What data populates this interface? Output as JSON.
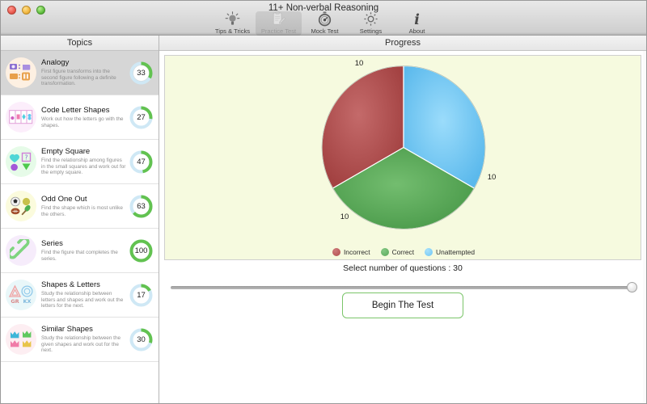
{
  "window": {
    "title": "11+ Non-verbal Reasoning",
    "traffic_lights": [
      "close-button",
      "minimize-button",
      "zoom-button"
    ]
  },
  "toolbar": {
    "items": [
      {
        "label": "Tips & Tricks",
        "icon": "lightbulb-icon",
        "selected": false
      },
      {
        "label": "Practice Test",
        "icon": "clipboard-pencil-icon",
        "selected": true
      },
      {
        "label": "Mock Test",
        "icon": "stopwatch-icon",
        "selected": false
      },
      {
        "label": "Settings",
        "icon": "gear-icon",
        "selected": false
      },
      {
        "label": "About",
        "icon": "info-icon",
        "selected": false
      }
    ]
  },
  "sidebar": {
    "header": "Topics",
    "items": [
      {
        "title": "Analogy",
        "desc": "First figure transforms into the second figure following a definite transformation.",
        "score": "33",
        "percent": 33,
        "selected": true,
        "icon": "analogy-icon",
        "icon_bg": "#fdf0e2"
      },
      {
        "title": "Code Letter Shapes",
        "desc": "Work out how the letters go with the shapes.",
        "score": "27",
        "percent": 27,
        "selected": false,
        "icon": "code-letter-shapes-icon",
        "icon_bg": "#fceefb"
      },
      {
        "title": "Empty Square",
        "desc": "Find the relationship among figures in the small squares and work out for the empty square.",
        "score": "47",
        "percent": 47,
        "selected": false,
        "icon": "empty-square-icon",
        "icon_bg": "#e6fbe8"
      },
      {
        "title": "Odd One Out",
        "desc": "Find the shape which is most unlike the others.",
        "score": "63",
        "percent": 63,
        "selected": false,
        "icon": "odd-one-out-icon",
        "icon_bg": "#fbfbdd"
      },
      {
        "title": "Series",
        "desc": "Find the figure that completes the series.",
        "score": "100",
        "percent": 100,
        "selected": false,
        "icon": "chain-link-icon",
        "icon_bg": "#f6ecfb"
      },
      {
        "title": "Shapes & Letters",
        "desc": "Study the relationship between letters and shapes and work out the letters for the next.",
        "score": "17",
        "percent": 17,
        "selected": false,
        "icon": "shapes-letters-icon",
        "icon_bg": "#e9f7f9"
      },
      {
        "title": "Similar Shapes",
        "desc": "Study the relationship between the given shapes and work out for the next.",
        "score": "30",
        "percent": 30,
        "selected": false,
        "icon": "similar-shapes-icon",
        "icon_bg": "#fdeef2"
      }
    ]
  },
  "main": {
    "header": "Progress",
    "question_count_label": "Select number of questions : 30",
    "slider": {
      "value": 30,
      "min": 5,
      "max": 30,
      "percent": 100
    },
    "begin_button": "Begin The Test"
  },
  "chart_data": {
    "type": "pie",
    "title": "Progress",
    "categories": [
      "Incorrect",
      "Correct",
      "Unattempted"
    ],
    "values": [
      10,
      10,
      10
    ],
    "labels": [
      "10",
      "10",
      "10"
    ],
    "colors": [
      "#b24c4c",
      "#5aa85a",
      "#6ec6f5"
    ],
    "legend_position": "bottom",
    "grid": false,
    "background": "#f6fadf"
  },
  "colors": {
    "incorrect": "#b24c4c",
    "correct": "#5aa85a",
    "unattempted": "#6ec6f5",
    "ring_progress": "#62c250",
    "ring_track": "#cfe8f5",
    "accent_border": "#7bc56a"
  }
}
